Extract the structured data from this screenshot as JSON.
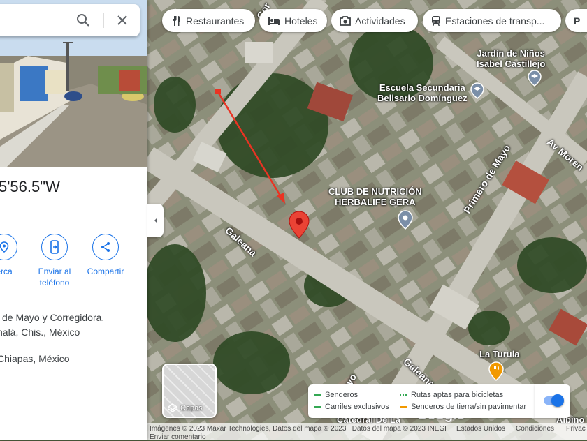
{
  "panel": {
    "coordinates": "5'56.5\"W",
    "actions": [
      {
        "label": "erca",
        "icon": "nearby-icon"
      },
      {
        "label": "Enviar al teléfono",
        "icon": "send-to-phone-icon"
      },
      {
        "label": "Compartir",
        "icon": "share-icon"
      }
    ],
    "address_line1": "l de Mayo y Corregidora,",
    "address_line2": "halá, Chis., México",
    "region": "Chiapas, México"
  },
  "chips": [
    {
      "label": "Restaurantes",
      "icon": "restaurant-icon"
    },
    {
      "label": "Hoteles",
      "icon": "hotel-icon"
    },
    {
      "label": "Actividades",
      "icon": "camera-icon"
    },
    {
      "label": "Estaciones de transp...",
      "icon": "transit-icon"
    },
    {
      "label": "P",
      "icon": ""
    }
  ],
  "map": {
    "places": [
      {
        "name": "Jardín de Niños\nIsabel Castillejo",
        "icon": "school-icon"
      },
      {
        "name": "Escuela Secundaria\nBelisario Domínguez",
        "icon": "school-icon"
      },
      {
        "name": "CLUB DE NUTRICIÓN\nHERBALIFE GERA",
        "icon": "pin-icon"
      },
      {
        "name": "La Turula",
        "icon": "restaurant-icon"
      }
    ],
    "streets": {
      "galeana_1": "Galeana",
      "galeana_2": "Galeana",
      "primero_de_mayo": "Primero de Mayo",
      "de_mayo": "de Mayo",
      "av_moren": "Av Moren",
      "cor": "Cor",
      "catedral": "Catedral De La",
      "albino": "Albino"
    }
  },
  "layers": {
    "label": "Capas"
  },
  "legend": {
    "items": [
      {
        "label": "Senderos",
        "color": "#34a853",
        "style": "solid"
      },
      {
        "label": "Carriles exclusivos",
        "color": "#34a853",
        "style": "solid"
      },
      {
        "label": "Rutas aptas para bicicletas",
        "color": "#34a853",
        "style": "dotted"
      },
      {
        "label": "Senderos de tierra/sin pavimentar",
        "color": "#f29900",
        "style": "dashed"
      }
    ],
    "toggle_on": true
  },
  "footer": {
    "imagery": "Imágenes © 2023 Maxar Technologies, Datos del mapa © 2023 , Datos del mapa © 2023 INEGI",
    "country": "Estados Unidos",
    "terms": "Condiciones",
    "privacy": "Privac",
    "feedback": "Enviar comentario",
    "brand": "Google"
  },
  "colors": {
    "accent": "#1a73e8",
    "arrow": "#ea3323",
    "pin": "#ea4335"
  }
}
